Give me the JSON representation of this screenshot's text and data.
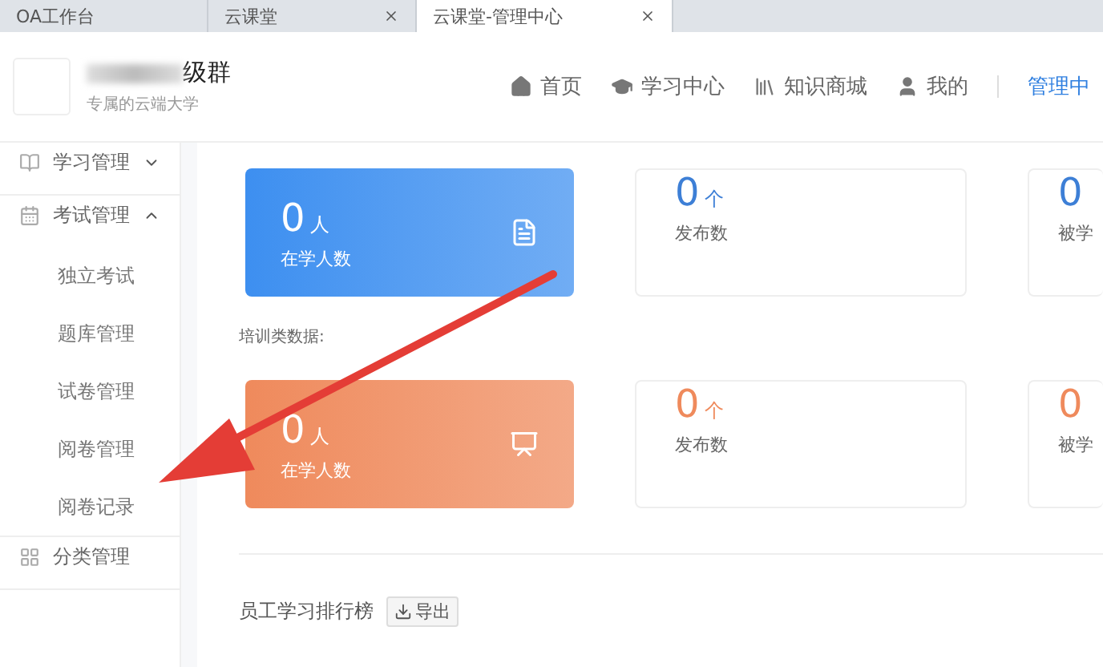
{
  "browser_tabs": [
    {
      "title": "OA工作台",
      "selected": false
    },
    {
      "title": "云课堂",
      "selected": false
    },
    {
      "title": "云课堂-管理中心",
      "selected": true
    }
  ],
  "brand": {
    "name": "级群",
    "subtitle": "专属的云端大学"
  },
  "nav": [
    {
      "kind": "home",
      "label": "首页",
      "selected": false
    },
    {
      "kind": "study",
      "label": "学习中心",
      "selected": false
    },
    {
      "kind": "store",
      "label": "知识商城",
      "selected": false
    },
    {
      "kind": "me",
      "label": "我的",
      "selected": false
    },
    {
      "kind": "admin",
      "label": "管理中",
      "selected": true
    }
  ],
  "sidebar": [
    {
      "kind": "book",
      "label": "学习管理",
      "expanded": false
    },
    {
      "kind": "exam",
      "label": "考试管理",
      "expanded": true,
      "children": [
        {
          "label": "独立考试"
        },
        {
          "label": "题库管理"
        },
        {
          "label": "试卷管理"
        },
        {
          "label": "阅卷管理"
        },
        {
          "label": "阅卷记录"
        }
      ]
    },
    {
      "kind": "grid",
      "label": "分类管理"
    }
  ],
  "sections": [
    {
      "stats": [
        {
          "kind": "hero",
          "color": "#3d8ff0",
          "value": "0",
          "unit": "人",
          "label": "在学人数"
        },
        {
          "kind": "plain",
          "value": "0",
          "unit": "个",
          "label": "发布数"
        },
        {
          "kind": "cut",
          "value": "0",
          "label": "被学"
        }
      ]
    },
    {
      "title": "培训类数据:",
      "stats": [
        {
          "kind": "hero",
          "color": "#ef8a5c",
          "value": "0",
          "unit": "人",
          "label": "在学人数"
        },
        {
          "kind": "plain",
          "value": "0",
          "unit": "个",
          "label": "发布数"
        },
        {
          "kind": "cut",
          "value": "0",
          "label": "被学"
        }
      ]
    }
  ],
  "ranking": {
    "title": "员工学习排行榜",
    "export_label": "导出"
  }
}
